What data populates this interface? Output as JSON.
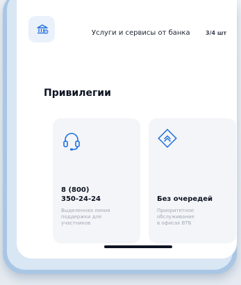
{
  "services": {
    "label": "Услуги и сервисы от банка",
    "count": "3/4 шт",
    "icon": "bank-services-icon"
  },
  "privileges": {
    "title": "Привилегии",
    "cards": [
      {
        "icon": "headset-icon",
        "title_line1": "8 (800)",
        "title_line2": "350-24-24",
        "desc_line1": "Выделенная линия",
        "desc_line2": "поддержки для",
        "desc_line3": "участников"
      },
      {
        "icon": "priority-chevrons-icon",
        "title_line1": "Без очередей",
        "desc_line1": "Приоритетное",
        "desc_line2": "обслуживание",
        "desc_line3": "в офисах ВТБ"
      }
    ]
  },
  "colors": {
    "accent": "#1f6fe0",
    "text_primary": "#0e1422",
    "text_secondary": "#a3a9b4",
    "card_bg": "#f3f5f8"
  }
}
